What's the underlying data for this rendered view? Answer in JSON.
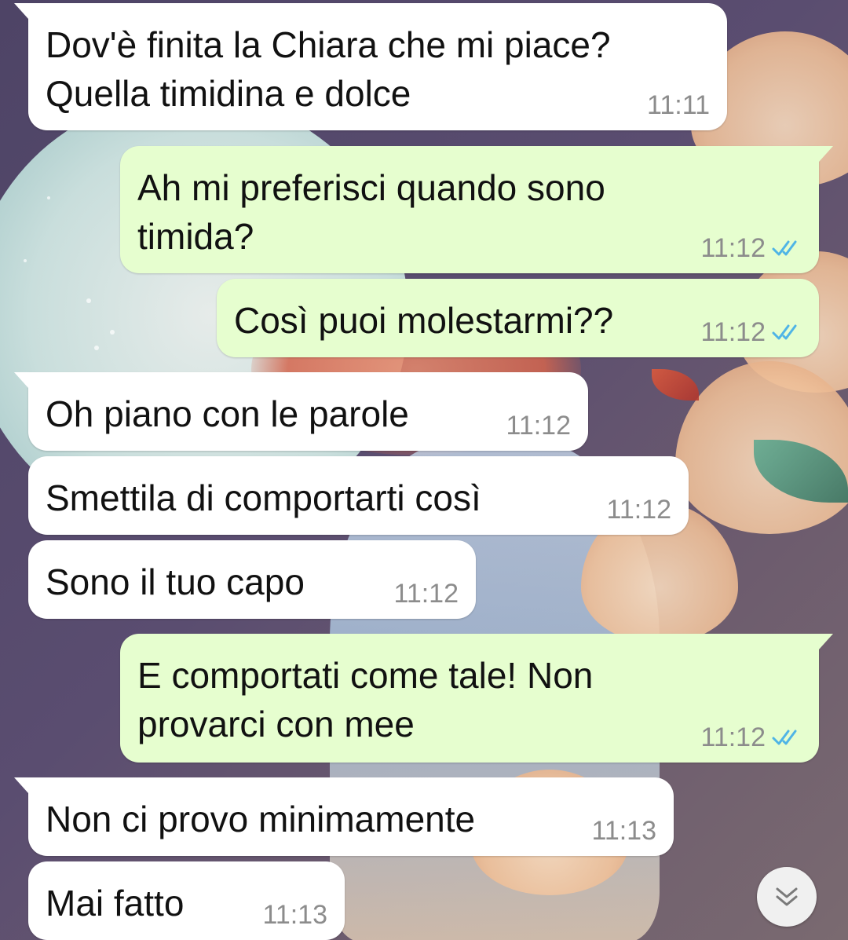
{
  "chat": {
    "messages": [
      {
        "direction": "in",
        "text": "Dov'è finita la Chiara che mi piace?\nQuella timidina e dolce",
        "time": "11:11"
      },
      {
        "direction": "out",
        "text": "Ah mi preferisci quando sono\ntimida?",
        "time": "11:12",
        "status": "read"
      },
      {
        "direction": "out",
        "text": "Così puoi molestarmi??",
        "time": "11:12",
        "status": "read"
      },
      {
        "direction": "in",
        "text": "Oh piano con le parole",
        "time": "11:12"
      },
      {
        "direction": "in",
        "text": "Smettila di comportarti così",
        "time": "11:12"
      },
      {
        "direction": "in",
        "text": "Sono il tuo capo",
        "time": "11:12"
      },
      {
        "direction": "out",
        "text": "E comportati come tale! Non\nprovarci con mee",
        "time": "11:12",
        "status": "read"
      },
      {
        "direction": "in",
        "text": "Non ci provo minimamente",
        "time": "11:13"
      },
      {
        "direction": "in",
        "text": "Mai fatto",
        "time": "11:13"
      }
    ]
  },
  "colors": {
    "incoming_bubble": "#ffffff",
    "outgoing_bubble": "#e6fecf",
    "read_ticks": "#4fb4e6",
    "timestamp": "#8c8c8c"
  },
  "icons": {
    "read_status": "double-check-icon",
    "scroll_down": "double-chevron-down-icon"
  }
}
